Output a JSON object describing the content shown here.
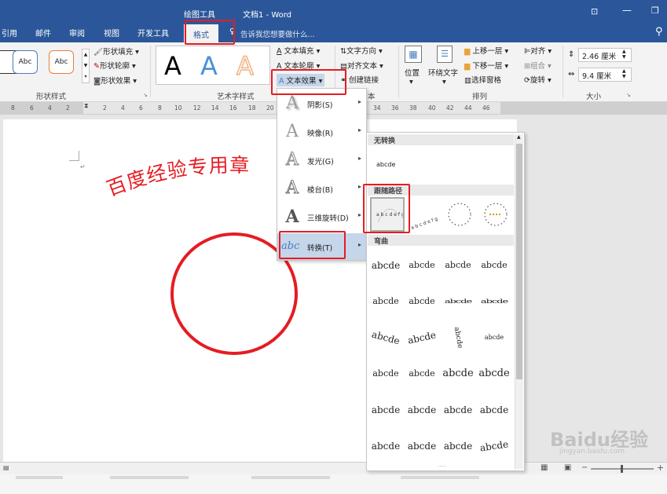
{
  "titlebar": {
    "context_tab": "绘图工具",
    "title": "文档1 - Word"
  },
  "tabs": [
    {
      "label": "引用"
    },
    {
      "label": "邮件"
    },
    {
      "label": "审阅"
    },
    {
      "label": "视图"
    },
    {
      "label": "开发工具"
    },
    {
      "label": "格式"
    }
  ],
  "tell_me": "告诉我您想要做什么...",
  "ribbon": {
    "shape_styles": {
      "samples": [
        "Abc",
        "Abc"
      ],
      "fill": "形状填充",
      "outline": "形状轮廓",
      "effects": "形状效果",
      "group_label": "形状样式"
    },
    "wordart": {
      "samples": [
        "A",
        "A",
        "A"
      ],
      "text_fill": "文本填充",
      "text_outline": "文本轮廓",
      "text_effects": "文本效果",
      "group_label": "艺术字样式"
    },
    "text": {
      "direction": "文字方向",
      "align": "对齐文本",
      "link": "创建链接",
      "group_label": "本"
    },
    "arrange": {
      "position": "位置",
      "wrap": "环绕文字",
      "forward": "上移一层",
      "backward": "下移一层",
      "pane": "选择窗格",
      "align": "对齐",
      "group": "组合",
      "rotate": "旋转",
      "group_label": "排列"
    },
    "size": {
      "height": "2.46 厘米",
      "width": "9.4 厘米",
      "group_label": "大小"
    }
  },
  "ruler": {
    "left_numbers": [
      "8",
      "6",
      "4",
      "2",
      "2"
    ],
    "numbers": [
      "2",
      "4",
      "6",
      "8",
      "10",
      "12",
      "14",
      "16",
      "18",
      "20"
    ],
    "right_numbers": [
      "34",
      "36",
      "38",
      "40",
      "42",
      "44",
      "46"
    ]
  },
  "document": {
    "arc_text": "百度经验专用章"
  },
  "text_effects_menu": [
    {
      "label": "阴影(S)"
    },
    {
      "label": "映像(R)"
    },
    {
      "label": "发光(G)"
    },
    {
      "label": "棱台(B)"
    },
    {
      "label": "三维旋转(D)"
    },
    {
      "label": "转换(T)"
    }
  ],
  "transform_gallery": {
    "no_transform_header": "无转换",
    "no_transform_sample": "abcde",
    "follow_path_header": "跟随路径",
    "warp_header": "弯曲",
    "warp_samples": [
      "abcde",
      "abcde",
      "abcde",
      "abcde",
      "abcde",
      "abcde",
      "abcde",
      "abcde",
      "abcde",
      "abcde",
      "abcde",
      "abcde",
      "abcde",
      "abcde",
      "abcde",
      "abcde",
      "abcde",
      "abcde",
      "abcde",
      "abcde",
      "abcde",
      "abcde",
      "abcde",
      "abcde"
    ]
  },
  "watermark": "Baidu经验",
  "watermark_sub": "jingyan.baidu.com",
  "colors": {
    "accent": "#2b579a",
    "highlight": "#e51c23"
  }
}
